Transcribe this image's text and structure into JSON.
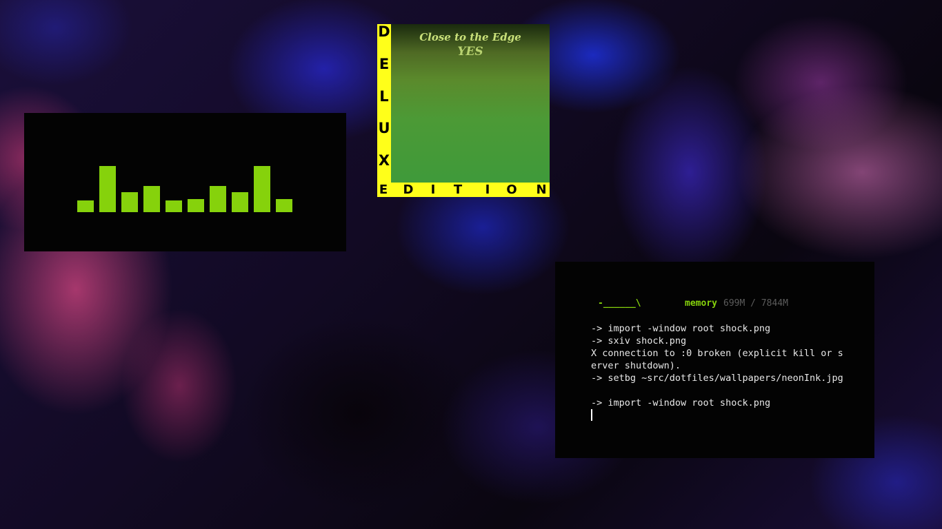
{
  "wallpaper": {
    "name": "neonInk"
  },
  "visualizer": {
    "color": "#86d20c",
    "bar_levels": [
      0.25,
      1.0,
      0.44,
      0.56,
      0.25,
      0.29,
      0.56,
      0.44,
      1.0,
      0.29
    ]
  },
  "album": {
    "title": "Close to the Edge",
    "band": "YES",
    "deluxe_letters": [
      "D",
      "E",
      "L",
      "U",
      "X"
    ],
    "edition_letters": [
      "E",
      "D",
      "I",
      "T",
      "I",
      "O",
      "N"
    ],
    "frame_color": "#ffff1a"
  },
  "terminal": {
    "prompt_art": "-______\\",
    "memory_label": "memory",
    "memory_value": "699M / 7844M",
    "lines": [
      "-> import -window root shock.png",
      "-> sxiv shock.png",
      "X connection to :0 broken (explicit kill or server shutdown).",
      "-> setbg ~src/dotfiles/wallpapers/neonInk.jpg",
      "",
      "-> import -window root shock.png"
    ],
    "accent_color": "#86d20c"
  }
}
